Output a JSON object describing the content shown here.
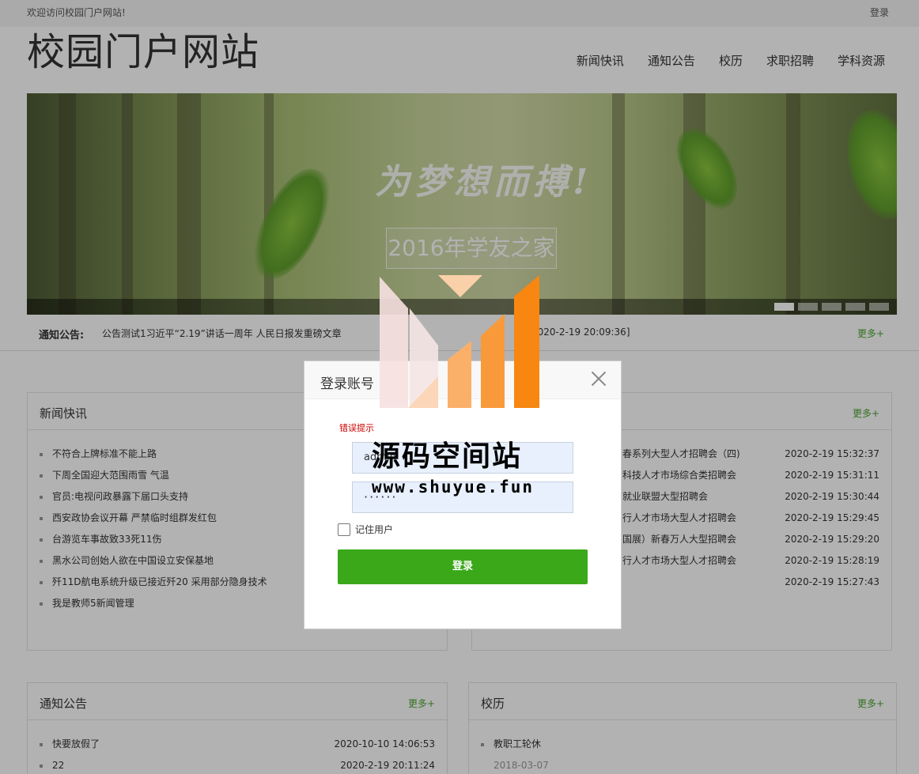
{
  "topbar": {
    "welcome": "欢迎访问校园门户网站!",
    "login": "登录"
  },
  "header": {
    "title": "校园门户网站",
    "nav": [
      "新闻快讯",
      "通知公告",
      "校历",
      "求职招聘",
      "学科资源"
    ]
  },
  "banner": {
    "slogan": "为梦想而搏!",
    "subtitle": "2016年学友之家",
    "slide_count": 5,
    "active_slide": 1
  },
  "notice_strip": {
    "label": "通知公告:",
    "text": "公告测试1习近平“2.19”讲话一周年 人民日报发重磅文章",
    "time": "2020-2-19 20:09:36]",
    "more": "更多+"
  },
  "news": {
    "title": "新闻快讯",
    "items": [
      "不符合上牌标准不能上路",
      "下周全国迎大范围雨雪 气温",
      "官员:电视问政暴露下届口头支持",
      "西安政协会议开幕 严禁临时组群发红包",
      "台游览车事故致33死11伤",
      "黑水公司创始人欲在中国设立安保基地",
      "歼11D航电系统升级已接近歼20 采用部分隐身技术",
      "我是教师5新闻管理"
    ]
  },
  "jobs": {
    "more": "更多+",
    "items": [
      {
        "title": "春系列大型人才招聘会（四)",
        "date": "2020-2-19 15:32:37"
      },
      {
        "title": "科技人才市场综合类招聘会",
        "date": "2020-2-19 15:31:11"
      },
      {
        "title": "就业联盟大型招聘会",
        "date": "2020-2-19 15:30:44"
      },
      {
        "title": "行人才市场大型人才招聘会",
        "date": "2020-2-19 15:29:45"
      },
      {
        "title": "国展）新春万人大型招聘会",
        "date": "2020-2-19 15:29:20"
      },
      {
        "title": "行人才市场大型人才招聘会",
        "date": "2020-2-19 15:28:19"
      },
      {
        "title": "",
        "date": "2020-2-19 15:27:43"
      }
    ]
  },
  "notices": {
    "title": "通知公告",
    "more": "更多+",
    "items": [
      {
        "title": "快要放假了",
        "date": "2020-10-10 14:06:53"
      },
      {
        "title": "22",
        "date": "2020-2-19 20:11:24"
      }
    ]
  },
  "calendar": {
    "title": "校历",
    "more": "更多+",
    "items": [
      {
        "title": "教职工轮休",
        "date": "2018-03-07"
      }
    ]
  },
  "modal": {
    "title": "登录账号",
    "error": "错误提示",
    "username_value": "admin",
    "password_value": "······",
    "remember_label": "记住用户",
    "login_button": "登录"
  },
  "watermark": {
    "name": "源码空间站",
    "url": "www.shuyue.fun"
  },
  "colors": {
    "accent_green": "#3aa819",
    "more_link": "#4aa431",
    "error_red": "#cc0000",
    "input_bg": "#e8f0fe"
  }
}
